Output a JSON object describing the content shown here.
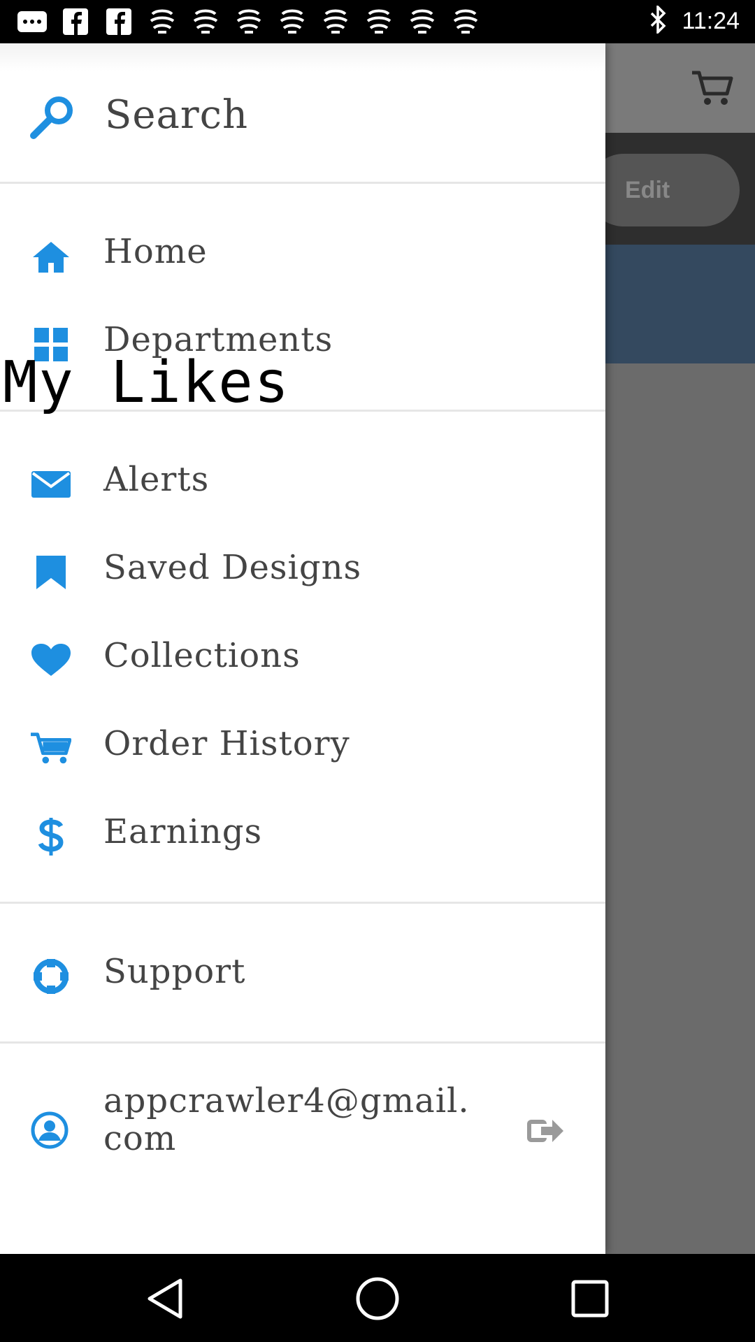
{
  "status_bar": {
    "time": "11:24",
    "notification_icons": [
      "messages-icon",
      "facebook-icon",
      "facebook-icon",
      "app-icon",
      "app-icon",
      "app-icon",
      "app-icon",
      "app-icon",
      "app-icon",
      "app-icon",
      "app-icon"
    ],
    "bluetooth_icon": "bluetooth-icon"
  },
  "background_app": {
    "edit_label": "Edit",
    "cart_icon": "cart-icon"
  },
  "drawer": {
    "search_placeholder": "Search",
    "items": [
      {
        "label": "Home",
        "icon": "home-icon"
      },
      {
        "label": "Departments",
        "icon": "grid-icon"
      },
      {
        "label": "Alerts",
        "icon": "mail-icon"
      },
      {
        "label": "Saved Designs",
        "icon": "bookmark-icon"
      },
      {
        "label": "Collections",
        "icon": "heart-icon"
      },
      {
        "label": "Order History",
        "icon": "cart-icon"
      },
      {
        "label": "Earnings",
        "icon": "dollar-icon"
      },
      {
        "label": "Support",
        "icon": "lifebuoy-icon"
      }
    ],
    "overlay_text": "My Likes",
    "account": {
      "email": "appcrawler4@gmail.com",
      "email_line1": "appcrawler4@gmail.",
      "email_line2": "com",
      "logout_icon": "logout-icon"
    }
  },
  "colors": {
    "accent": "#1e8fe0",
    "drawer_bg": "#ffffff",
    "text": "#444444",
    "banner": "#34495f"
  }
}
